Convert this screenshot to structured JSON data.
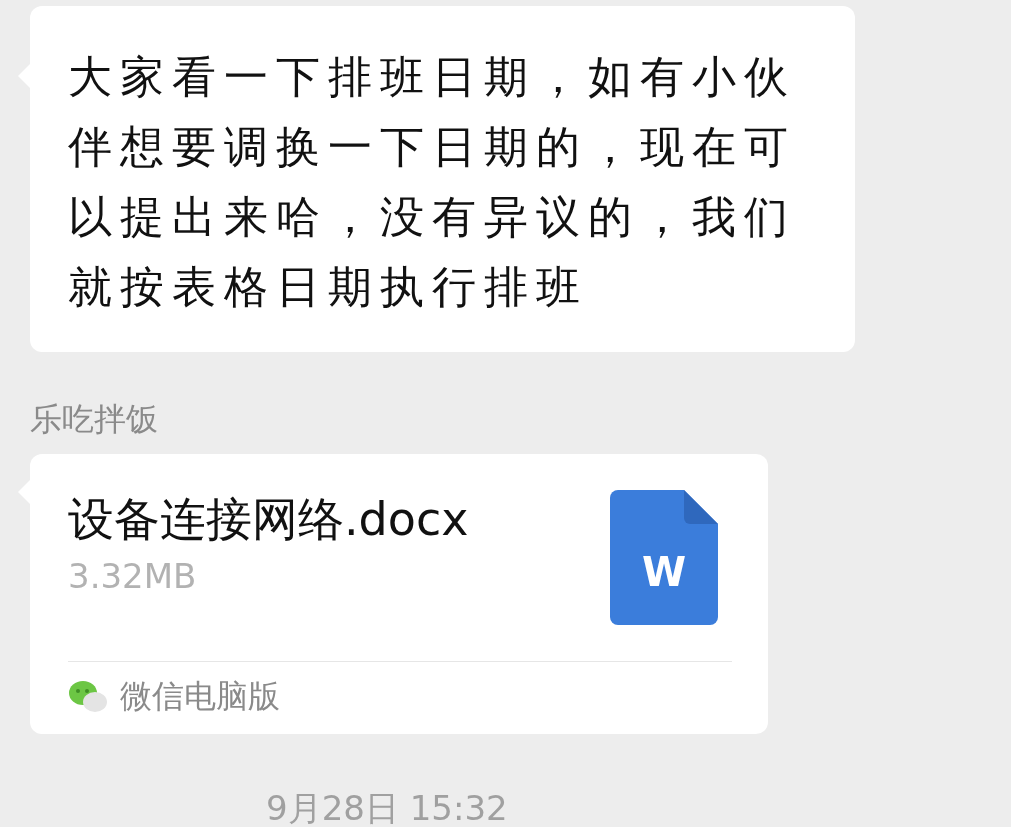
{
  "messages": [
    {
      "kind": "text",
      "text": "大家看一下排班日期，如有小伙伴想要调换一下日期的，现在可以提出来哈，没有异议的，我们就按表格日期执行排班"
    },
    {
      "kind": "file",
      "sender": "乐吃拌饭",
      "file_name": "设备连接网络.docx",
      "file_size": "3.32MB",
      "file_badge": "W",
      "source": "微信电脑版"
    }
  ],
  "timestamp": "9月28日 15:32"
}
